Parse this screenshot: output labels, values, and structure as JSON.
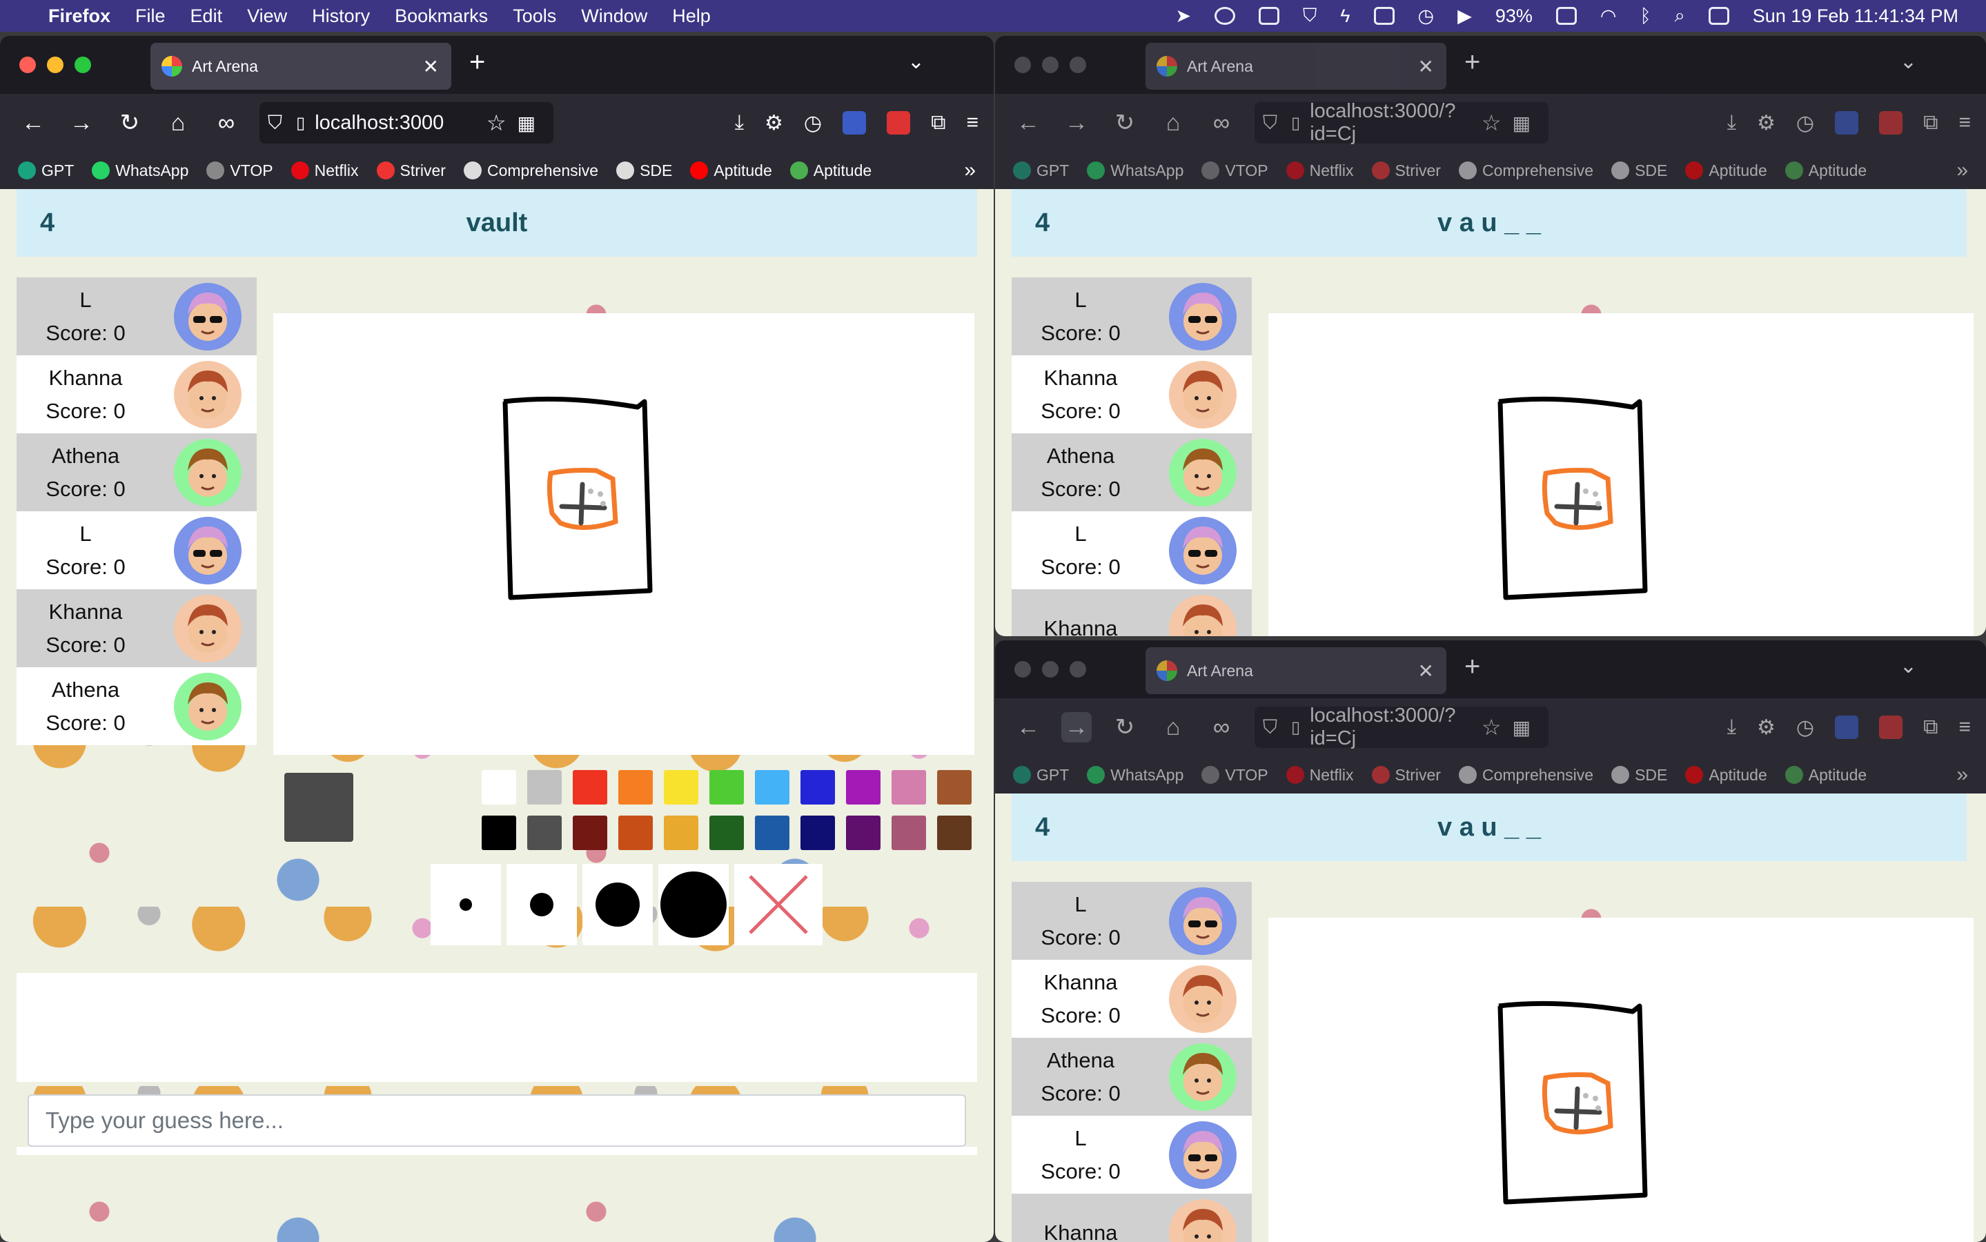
{
  "menubar": {
    "app": "Firefox",
    "items": [
      "File",
      "Edit",
      "View",
      "History",
      "Bookmarks",
      "Tools",
      "Window",
      "Help"
    ],
    "battery": "93%",
    "datetime": "Sun 19 Feb  11:41:34 PM"
  },
  "browser": {
    "tab_title": "Art Arena",
    "bookmarks": [
      "GPT",
      "WhatsApp",
      "VTOP",
      "Netflix",
      "Striver",
      "Comprehensive",
      "SDE",
      "Aptitude",
      "Aptitude"
    ],
    "bookmark_colors": [
      "#19a37f",
      "#25d366",
      "#888888",
      "#e50914",
      "#e33",
      "#dddddd",
      "#dddddd",
      "#ff0000",
      "#4caf50"
    ]
  },
  "windows": [
    {
      "url": "localhost:3000",
      "round": "4",
      "word": "vault",
      "players": [
        {
          "name": "L",
          "score": "Score: 0"
        },
        {
          "name": "Khanna",
          "score": "Score: 0"
        },
        {
          "name": "Athena",
          "score": "Score: 0"
        },
        {
          "name": "L",
          "score": "Score: 0"
        },
        {
          "name": "Khanna",
          "score": "Score: 0"
        },
        {
          "name": "Athena",
          "score": "Score: 0"
        }
      ],
      "guess_placeholder": "Type your guess here..."
    },
    {
      "url": "localhost:3000/?id=Cj",
      "round": "4",
      "word": "v a u _ _",
      "players": [
        {
          "name": "L",
          "score": "Score: 0"
        },
        {
          "name": "Khanna",
          "score": "Score: 0"
        },
        {
          "name": "Athena",
          "score": "Score: 0"
        },
        {
          "name": "L",
          "score": "Score: 0"
        },
        {
          "name": "Khanna",
          "score": ""
        }
      ]
    },
    {
      "url": "localhost:3000/?id=Cj",
      "round": "4",
      "word": "v a u _ _",
      "players": [
        {
          "name": "L",
          "score": "Score: 0"
        },
        {
          "name": "Khanna",
          "score": "Score: 0"
        },
        {
          "name": "Athena",
          "score": "Score: 0"
        },
        {
          "name": "L",
          "score": "Score: 0"
        },
        {
          "name": "Khanna",
          "score": ""
        }
      ]
    }
  ],
  "palette": [
    "#ffffff",
    "#c1c1c1",
    "#ef3321",
    "#f57e22",
    "#f9e22e",
    "#4fcc34",
    "#44b2f7",
    "#2425d6",
    "#a31ab7",
    "#d37ead",
    "#a0562c",
    "#000000",
    "#505050",
    "#741814",
    "#c84e18",
    "#e8a92f",
    "#1f6220",
    "#1e5ba7",
    "#0f0e73",
    "#5f0f6c",
    "#a75574",
    "#62391c"
  ],
  "current_color": "#4a4a4a",
  "brush_sizes": [
    "tiny",
    "small",
    "medium",
    "large"
  ],
  "eraser": "clear-canvas",
  "avatar_colors": {
    "L": "#7b93e8",
    "Khanna": "#f6c7a6",
    "Athena": "#8ff59b"
  }
}
